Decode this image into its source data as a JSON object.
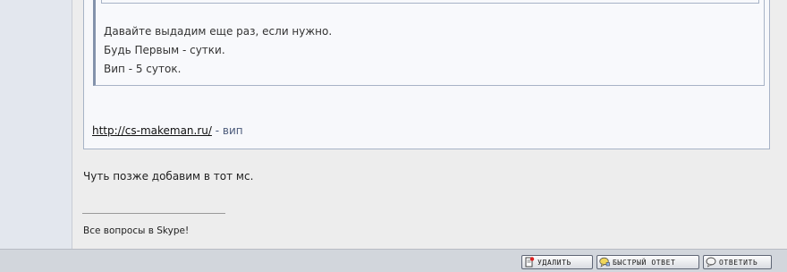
{
  "quote": {
    "lines": [
      "Давайте выдадим еще раз, если нужно.",
      "Будь Первым - сутки.",
      "Вип - 5 суток."
    ]
  },
  "post": {
    "link_url_text": "http://cs-makeman.ru/",
    "link_suffix": " - вип",
    "text": "Чуть позже добавим в тот мс.",
    "signature": "Все вопросы в Skype!"
  },
  "actions": {
    "delete_label": "УДАЛИТЬ",
    "quick_reply_label": "БЫСТРЫЙ ОТВЕТ",
    "reply_label": "ОТВЕТИТЬ"
  },
  "colors": {
    "quote_border": "#8392ab",
    "link_suffix": "#4b5a7a",
    "bottom_bar": "#d2d6dc"
  }
}
